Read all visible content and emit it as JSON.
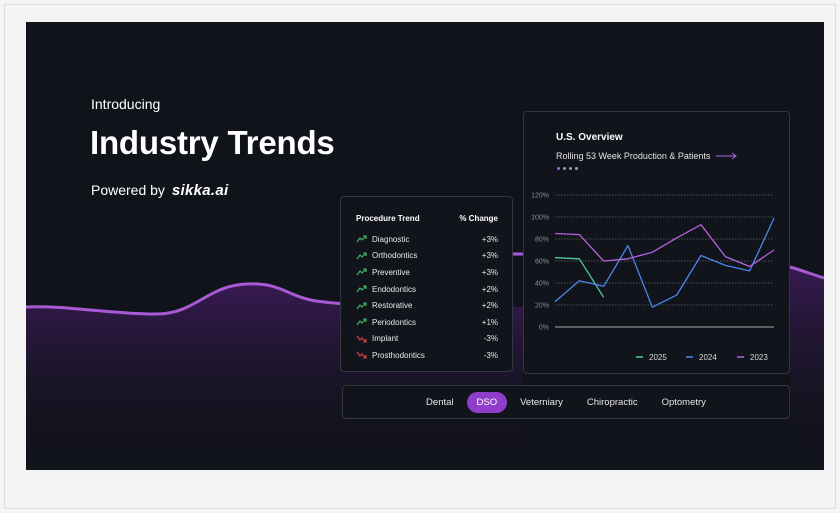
{
  "hero": {
    "intro": "Introducing",
    "title": "Industry Trends",
    "powered_by": "Powered by",
    "brand": "sikka.ai"
  },
  "procedure_trend": {
    "header_left": "Procedure Trend",
    "header_right": "% Change",
    "rows": [
      {
        "name": "Diagnostic",
        "change": "+3%",
        "direction": "up"
      },
      {
        "name": "Orthodontics",
        "change": "+3%",
        "direction": "up"
      },
      {
        "name": "Preventive",
        "change": "+3%",
        "direction": "up"
      },
      {
        "name": "Endodontics",
        "change": "+2%",
        "direction": "up"
      },
      {
        "name": "Restorative",
        "change": "+2%",
        "direction": "up"
      },
      {
        "name": "Periodontics",
        "change": "+1%",
        "direction": "up"
      },
      {
        "name": "Implant",
        "change": "-3%",
        "direction": "down"
      },
      {
        "name": "Prosthodontics",
        "change": "-3%",
        "direction": "down"
      }
    ],
    "up_color": "#3fbf6a",
    "down_color": "#e0474c"
  },
  "overview": {
    "title": "U.S. Overview",
    "subtitle": "Rolling 53 Week Production & Patients",
    "carousel_dots": 4,
    "active_dot": 0
  },
  "chart_data": {
    "type": "line",
    "y_ticks": [
      "120%",
      "100%",
      "80%",
      "60%",
      "40%",
      "20%",
      "0%"
    ],
    "ylim": [
      0,
      120
    ],
    "x_count": 11,
    "grid": true,
    "legend_position": "bottom-right",
    "series": [
      {
        "name": "2025",
        "color": "#4fc9a2",
        "values": [
          63,
          62,
          27
        ]
      },
      {
        "name": "2024",
        "color": "#4b86e8",
        "values": [
          23,
          42,
          37,
          74,
          18,
          29,
          65,
          56,
          51,
          99
        ]
      },
      {
        "name": "2023",
        "color": "#b561e0",
        "values": [
          85,
          84,
          60,
          62,
          68,
          81,
          93,
          64,
          55,
          70
        ]
      }
    ]
  },
  "tabs": {
    "items": [
      "Dental",
      "DSO",
      "Veterniary",
      "Chiropractic",
      "Optometry"
    ],
    "active": "DSO"
  }
}
